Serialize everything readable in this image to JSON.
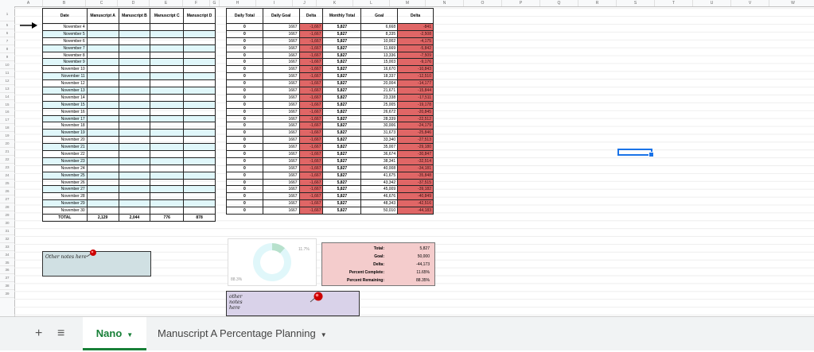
{
  "columns": [
    "A",
    "B",
    "C",
    "D",
    "E",
    "F",
    "G",
    "H",
    "I",
    "J",
    "K",
    "L",
    "M",
    "N",
    "O",
    "P",
    "Q",
    "R",
    "S",
    "T",
    "U",
    "V",
    "W"
  ],
  "rows": [
    "1",
    "5",
    "6",
    "7",
    "8",
    "9",
    "10",
    "11",
    "12",
    "13",
    "14",
    "15",
    "16",
    "17",
    "18",
    "19",
    "20",
    "21",
    "22",
    "23",
    "24",
    "25",
    "26",
    "27",
    "28",
    "29",
    "30",
    "31",
    "32",
    "33",
    "34",
    "35",
    "36",
    "37",
    "38",
    "39"
  ],
  "left_table": {
    "headers": [
      "Date",
      "Manuscript A",
      "Manuscript B",
      "Manuscript C",
      "Manuscript D"
    ],
    "dates": [
      "November 4",
      "November 5",
      "November 6",
      "November 7",
      "November 8",
      "November 9",
      "November 10",
      "November 11",
      "November 12",
      "November 13",
      "November 14",
      "November 15",
      "November 16",
      "November 17",
      "November 18",
      "November 19",
      "November 20",
      "November 21",
      "November 22",
      "November 23",
      "November 24",
      "November 25",
      "November 26",
      "November 27",
      "November 28",
      "November 29",
      "November 30"
    ],
    "total_row": [
      "TOTAL",
      "2,129",
      "2,044",
      "776",
      "878"
    ]
  },
  "right_table": {
    "headers": [
      "Daily Total",
      "Daily Goal",
      "Delta",
      "Monthly Total",
      "Goal",
      "Delta"
    ],
    "daily_total": "0",
    "daily_goal": "1667",
    "delta": "-1,667",
    "monthly_total": "5,827",
    "goals": [
      "6,668",
      "8,335",
      "10,002",
      "11,669",
      "13,336",
      "15,003",
      "16,670",
      "18,337",
      "20,004",
      "21,671",
      "23,338",
      "25,005",
      "26,672",
      "28,339",
      "30,006",
      "31,673",
      "33,340",
      "35,007",
      "36,674",
      "38,341",
      "40,008",
      "41,675",
      "43,342",
      "45,009",
      "46,676",
      "48,343",
      "50,010"
    ],
    "deltas": [
      "-841",
      "-2,508",
      "-4,175",
      "-5,842",
      "-7,509",
      "-9,176",
      "-10,843",
      "-12,510",
      "-14,177",
      "-15,844",
      "-17,511",
      "-19,178",
      "-20,845",
      "-22,512",
      "-24,179",
      "-25,846",
      "-27,513",
      "-29,180",
      "-30,847",
      "-32,514",
      "-34,181",
      "-35,848",
      "-37,515",
      "-39,182",
      "-40,849",
      "-42,516",
      "-44,183"
    ]
  },
  "chart_data": {
    "type": "pie",
    "donut": true,
    "values": [
      11.7,
      88.3
    ],
    "labels": [
      "11.7%",
      "88.3%"
    ],
    "colors": [
      "#b7e1cd",
      "#e0f7fa"
    ]
  },
  "summary": [
    {
      "label": "Total:",
      "value": "5,827"
    },
    {
      "label": "Goal:",
      "value": "50,000"
    },
    {
      "label": "Delta:",
      "value": "-44,173"
    },
    {
      "label": "Percent Complete:",
      "value": "11.65%"
    },
    {
      "label": "Percent Remaining:",
      "value": "88.35%"
    }
  ],
  "notes": {
    "note1": "Other notes here",
    "note2": "other notes here"
  },
  "colors": {
    "accent_green": "#188038",
    "delta_red": "#e06666",
    "alt_row": "#e0f7fa",
    "summary_bg": "#f4cccc",
    "note1_bg": "#d0e0e3",
    "note2_bg": "#d9d2e9",
    "selection": "#1a73e8"
  },
  "tabbar": {
    "add_icon": "plus-icon",
    "menu_icon": "list-icon",
    "tabs": [
      {
        "label": "Nano",
        "active": true
      },
      {
        "label": "Manuscript A Percentage Planning",
        "active": false
      }
    ]
  }
}
